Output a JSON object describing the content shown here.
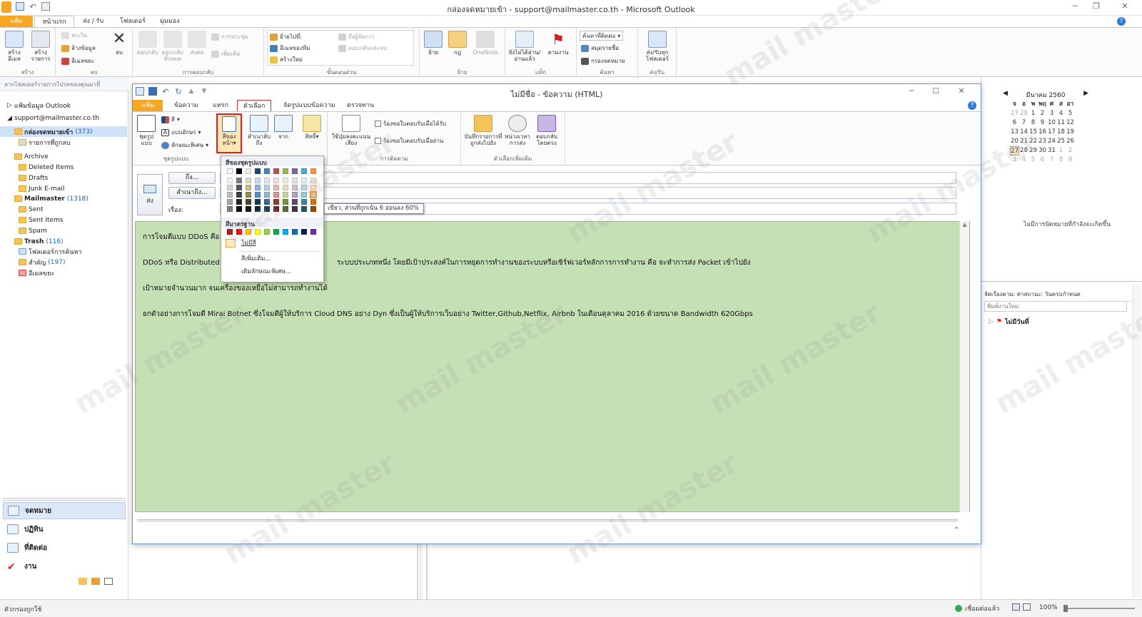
{
  "window": {
    "title": "กล่องจดหมายเข้า - support@mailmaster.co.th - Microsoft Outlook"
  },
  "main_tabs": [
    "แฟ้ม",
    "หน้าแรก",
    "ส่ง / รับ",
    "โฟลเดอร์",
    "มุมมอง"
  ],
  "main_ribbon": {
    "groups": {
      "new": "สร้าง",
      "delete": "ลบ",
      "respond": "การตอบกลับ",
      "quick_steps": "ขั้นตอนด่วน",
      "move": "ย้าย",
      "tags": "แท็ก",
      "find": "ค้นหา",
      "send_receive": "ส่ง/รับ"
    },
    "new_email": "สร้างอีเมล",
    "new_items": "สร้างรายการ",
    "ignore": "ละเว้น",
    "clean_up": "ล้างข้อมูล",
    "junk": "อีเมลขยะ",
    "delete": "ลบ",
    "reply": "ตอบกลับ",
    "reply_all": "ตอบกลับทั้งหมด",
    "forward": "ส่งต่อ",
    "meeting": "การประชุม",
    "more": "เพิ่มเติม",
    "move_to": "ย้ายไปที่:",
    "to_manager": "ถึงผู้จัดการ",
    "team_email": "อีเมลของทีม",
    "reply_delete": "ตอบกลับและลบ",
    "create_new": "สร้างใหม่",
    "move": "ย้าย",
    "rules": "กฎ",
    "onenote": "OneNote",
    "unread_read": "ยังไม่ได้อ่าน/อ่านแล้ว",
    "follow_up": "ตามงาน",
    "find_contact": "ค้นหาที่ติดต่อ",
    "address_book": "สมุดรายชื่อ",
    "filter_email": "กรองจดหมาย",
    "send_receive_all": "ส่ง/รับทุกโฟลเดอร์"
  },
  "nav": {
    "header": "ลากโฟลเดอร์รายการโปรดของคุณมาที่",
    "items": [
      {
        "label": "แฟ้มข้อมูล Outlook",
        "count": ""
      },
      {
        "label": "support@mailmaster.co.th",
        "count": ""
      },
      {
        "label": "กล่องจดหมายเข้า",
        "count": "(373)"
      },
      {
        "label": "รายการที่ถูกลบ",
        "count": ""
      },
      {
        "label": "Archive",
        "count": ""
      },
      {
        "label": "Deleted Items",
        "count": ""
      },
      {
        "label": "Drafts",
        "count": ""
      },
      {
        "label": "Junk E-mail",
        "count": ""
      },
      {
        "label": "Mailmaster",
        "count": "(1318)"
      },
      {
        "label": "Sent",
        "count": ""
      },
      {
        "label": "Sent Items",
        "count": ""
      },
      {
        "label": "Spam",
        "count": ""
      },
      {
        "label": "Trash",
        "count": "(116)"
      },
      {
        "label": "โฟลเดอร์การค้นหา",
        "count": ""
      },
      {
        "label": "สำคัญ",
        "count": "(197)"
      },
      {
        "label": "อีเมลขยะ",
        "count": ""
      }
    ],
    "modules": [
      "จดหมาย",
      "ปฏิทิน",
      "ที่ติดต่อ",
      "งาน"
    ]
  },
  "todo": {
    "month": "มีนาคม 2560",
    "weekdays": [
      "จ",
      "อ",
      "พ",
      "พฤ",
      "ศ",
      "ส",
      "อา"
    ],
    "weeks": [
      [
        "27",
        "28",
        "1",
        "2",
        "3",
        "4",
        "5"
      ],
      [
        "6",
        "7",
        "8",
        "9",
        "10",
        "11",
        "12"
      ],
      [
        "13",
        "14",
        "15",
        "16",
        "17",
        "18",
        "19"
      ],
      [
        "20",
        "21",
        "22",
        "23",
        "24",
        "25",
        "26"
      ],
      [
        "27",
        "28",
        "29",
        "30",
        "31",
        "1",
        "2"
      ],
      [
        "3",
        "4",
        "5",
        "6",
        "7",
        "8",
        "9"
      ]
    ],
    "no_appointments": "ไม่มีการนัดหมายที่กำลังจะเกิดขึ้น",
    "arrange": "จัดเรียงตาม: ค่าสถานะ: วันครบกำหนด",
    "new_task_placeholder": "พิมพ์งานใหม่",
    "no_date": "ไม่มีวันที่"
  },
  "message": {
    "title": "ไม่มีชื่อ - ข้อความ (HTML)",
    "tabs": [
      "แฟ้ม",
      "ข้อความ",
      "แทรก",
      "ตัวเลือก",
      "จัดรูปแบบข้อความ",
      "ตรวจทาน"
    ],
    "ribbon": {
      "groups": {
        "themes": "ชุดรูปแบบ",
        "tracking": "การติดตาม",
        "more_options": "ตัวเลือกเพิ่มเติม"
      },
      "themes": "ชุดรูปแบบ",
      "colors": "สี",
      "fonts": "แบบอักษร",
      "effects": "ลักษณะพิเศษ",
      "page_color": "สีของหน้า",
      "bcc": "สำเนาลับถึง",
      "from": "จาก",
      "permission": "สิทธิ์",
      "voting": "ใช้ปุ่มลงคะแนนเสียง",
      "request_delivery": "ร้องขอใบตอบรับเมื่อได้รับ",
      "request_read": "ร้องขอใบตอบรับเมื่ออ่าน",
      "save_sent": "บันทึกรายการที่ถูกส่งไปยัง",
      "delay": "หน่วงเวลาการส่ง",
      "direct_replies": "ตอบกลับโดยตรง"
    },
    "send": "ส่ง",
    "to": "ถึง...",
    "cc": "สำเนาถึง...",
    "subject_label": "เรื่อง:",
    "body": [
      "การโจมตีแบบ DDoS คือ",
      "DDoS หรือ Distributed",
      "ระบบประเภทหนึ่ง โดยมีเป้าประสงค์ในการหยุดการทำงานของระบบหรือเซิร์ฟเวอร์หลักการการทำงาน คือ จะทำการส่ง Packet เข้าไปยัง",
      "เป้าหมายจำนวนมาก จนเครื่องของเหยื่อไม่สามารถทำงานได้",
      "ยกตัวอย่างการโจมตี Mirai Botnet ซึ่งโจมตีผู้ให้บริการ Cloud DNS อย่าง Dyn ซึ่งเป็นผู้ให้บริการเว็บอย่าง Twitter,Github,Netflix, Airbnb ในเดือนตุลาคม 2016 ด้วยขนาด Bandwidth 620Gbps"
    ]
  },
  "dropdown": {
    "theme_colors": "สีของชุดรูปแบบ",
    "standard_colors": "สีมาตรฐาน",
    "no_color": "ไม่มีสี",
    "more_colors": "สีเพิ่มเติม...",
    "fill_effects": "เติมลักษณะพิเศษ...",
    "tooltip": "เขียว, ส่วนที่ถูกเน้น 6 อ่อนลง 60%",
    "theme_top": [
      "#ffffff",
      "#000000",
      "#eeece1",
      "#1f497d",
      "#4f81bd",
      "#c0504d",
      "#9bbb59",
      "#8064a2",
      "#4bacc6",
      "#f79646"
    ],
    "theme_shades": [
      [
        "#f2f2f2",
        "#7f7f7f",
        "#ddd9c3",
        "#c6d9f0",
        "#dbe5f1",
        "#f2dcdb",
        "#ebf1dd",
        "#e5e0ec",
        "#dbeef3",
        "#fdeada"
      ],
      [
        "#d8d8d8",
        "#595959",
        "#c4bd97",
        "#8db3e2",
        "#b8cce4",
        "#e5b9b7",
        "#d7e3bc",
        "#ccc1d9",
        "#b7dde8",
        "#fbd5b5"
      ],
      [
        "#bfbfbf",
        "#3f3f3f",
        "#938953",
        "#548dd4",
        "#95b3d7",
        "#d99694",
        "#c3d69b",
        "#b2a2c7",
        "#92cddc",
        "#fac08f"
      ],
      [
        "#a5a5a5",
        "#262626",
        "#494429",
        "#17365d",
        "#366092",
        "#953734",
        "#76923c",
        "#5f497a",
        "#31859b",
        "#e36c09"
      ],
      [
        "#7f7f7f",
        "#0c0c0c",
        "#1d1b10",
        "#0f243e",
        "#244061",
        "#632423",
        "#4f6128",
        "#3f3151",
        "#205867",
        "#974806"
      ]
    ],
    "standard": [
      "#c00000",
      "#ff0000",
      "#ffc000",
      "#ffff00",
      "#92d050",
      "#00b050",
      "#00b0f0",
      "#0070c0",
      "#002060",
      "#7030a0"
    ]
  },
  "status": {
    "left": "ตัวกรองถูกใช้",
    "connected": "เชื่อมต่อแล้ว",
    "zoom": "100%"
  },
  "watermark": "mail master"
}
